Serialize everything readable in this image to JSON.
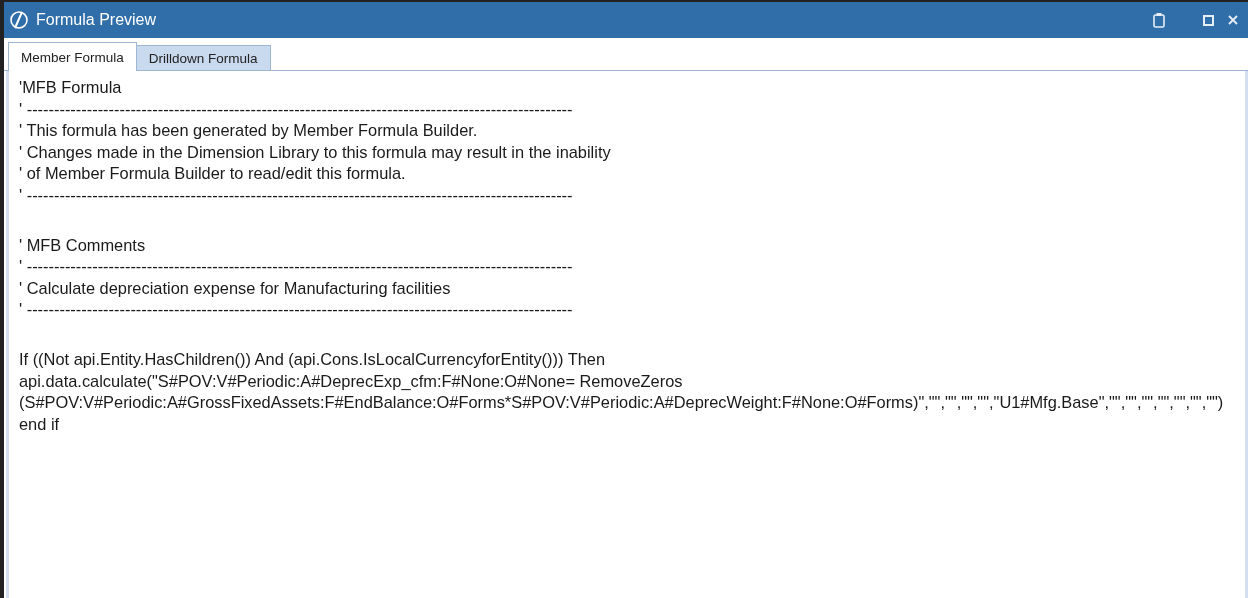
{
  "window": {
    "title": "Formula Preview"
  },
  "tabs": [
    {
      "label": "Member Formula",
      "selected": true
    },
    {
      "label": "Drilldown Formula",
      "selected": false
    }
  ],
  "editor": {
    "blocks": [
      [
        "'MFB Formula",
        "' ----------------------------------------------------------------------------------------------------",
        "' This formula has been generated by Member Formula Builder.",
        "' Changes made in the Dimension Library to this formula may result in the inability",
        "' of Member Formula Builder to read/edit this formula.",
        "' ----------------------------------------------------------------------------------------------------"
      ],
      [
        "' MFB Comments",
        "' ----------------------------------------------------------------------------------------------------",
        "' Calculate depreciation expense for Manufacturing facilities",
        "' ----------------------------------------------------------------------------------------------------"
      ],
      [
        "If ((Not api.Entity.HasChildren()) And (api.Cons.IsLocalCurrencyforEntity())) Then",
        "api.data.calculate(\"S#POV:V#Periodic:A#DeprecExp_cfm:F#None:O#None= RemoveZeros",
        "(S#POV:V#Periodic:A#GrossFixedAssets:F#EndBalance:O#Forms*S#POV:V#Periodic:A#DeprecWeight:F#None:O#Forms)\",\"\",\"\",\"\",\"\",\"U1#Mfg.Base\",\"\",\"\",\"\",\"\",\"\",\"\",\"\")",
        "end if"
      ]
    ]
  }
}
